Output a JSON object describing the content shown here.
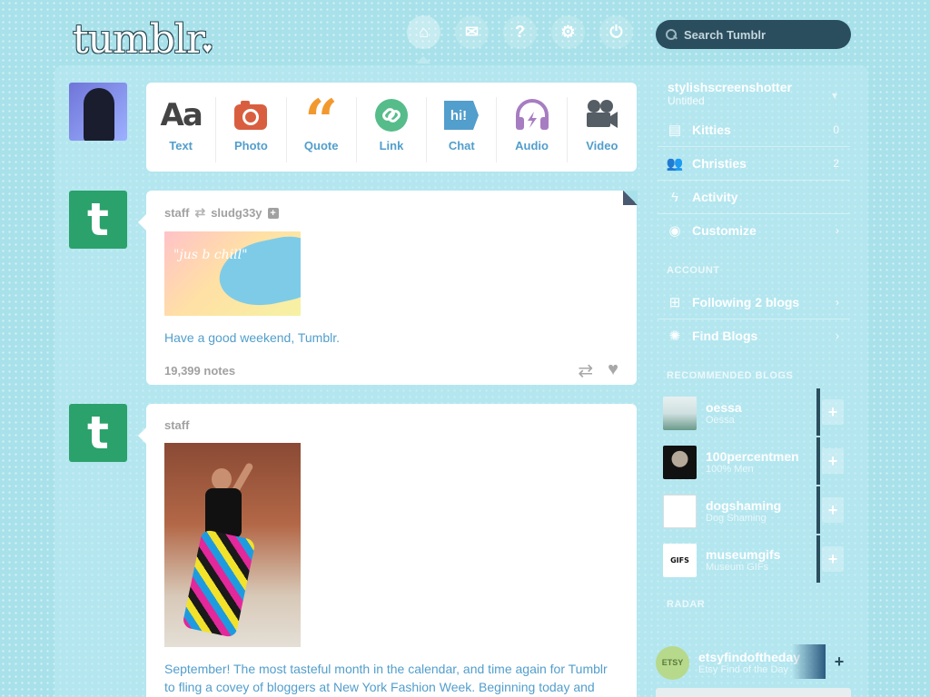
{
  "header": {
    "logo": "tumblr",
    "search_placeholder": "Search Tumblr"
  },
  "post_types": [
    {
      "label": "Text",
      "icon": "text-icon",
      "glyph": "Aa",
      "color": "#444444"
    },
    {
      "label": "Photo",
      "icon": "camera-icon",
      "glyph": "◉",
      "color": "#D95E40"
    },
    {
      "label": "Quote",
      "icon": "quote-icon",
      "glyph": "❝",
      "color": "#F2992E"
    },
    {
      "label": "Link",
      "icon": "link-icon",
      "glyph": "∞",
      "color": "#56BC8A"
    },
    {
      "label": "Chat",
      "icon": "chat-icon",
      "glyph": "hi!",
      "color": "#529ECC"
    },
    {
      "label": "Audio",
      "icon": "headphones-icon",
      "glyph": "♫",
      "color": "#A77DC2"
    },
    {
      "label": "Video",
      "icon": "video-camera-icon",
      "glyph": "■",
      "color": "#748089"
    }
  ],
  "posts": [
    {
      "author": "staff",
      "reblogged_from": "sludg33y",
      "image_text": "\"jus b chill\"",
      "text": "Have a good weekend, Tumblr.",
      "notes": "19,399 notes"
    },
    {
      "author": "staff",
      "text": "September! The most tasteful month in the calendar, and time again for Tumblr to fling a covey of bloggers at New York Fashion Week. Beginning today and"
    }
  ],
  "sidebar": {
    "blog": {
      "name": "stylishscreenshotter",
      "subtitle": "Untitled"
    },
    "items": [
      {
        "label": "Kitties",
        "count": "0",
        "icon": "post-icon"
      },
      {
        "label": "Christies",
        "count": "2",
        "icon": "followers-icon"
      },
      {
        "label": "Activity",
        "count": "",
        "icon": "lightning-icon"
      },
      {
        "label": "Customize",
        "count": "›",
        "icon": "eye-icon"
      }
    ],
    "account_heading": "ACCOUNT",
    "account_items": [
      {
        "label": "Following 2 blogs",
        "icon": "following-icon"
      },
      {
        "label": "Find Blogs",
        "icon": "find-blogs-icon"
      }
    ],
    "recommended_heading": "RECOMMENDED BLOGS",
    "recommended": [
      {
        "name": "oessa",
        "sub": "Oessa"
      },
      {
        "name": "100percentmen",
        "sub": "100% Men"
      },
      {
        "name": "dogshaming",
        "sub": "Dog Shaming"
      },
      {
        "name": "museumgifs",
        "sub": "Museum GIFs"
      }
    ],
    "radar_heading": "RADAR",
    "radar": {
      "name": "etsyfindoftheday",
      "sub": "Etsy Find of the Day"
    }
  }
}
